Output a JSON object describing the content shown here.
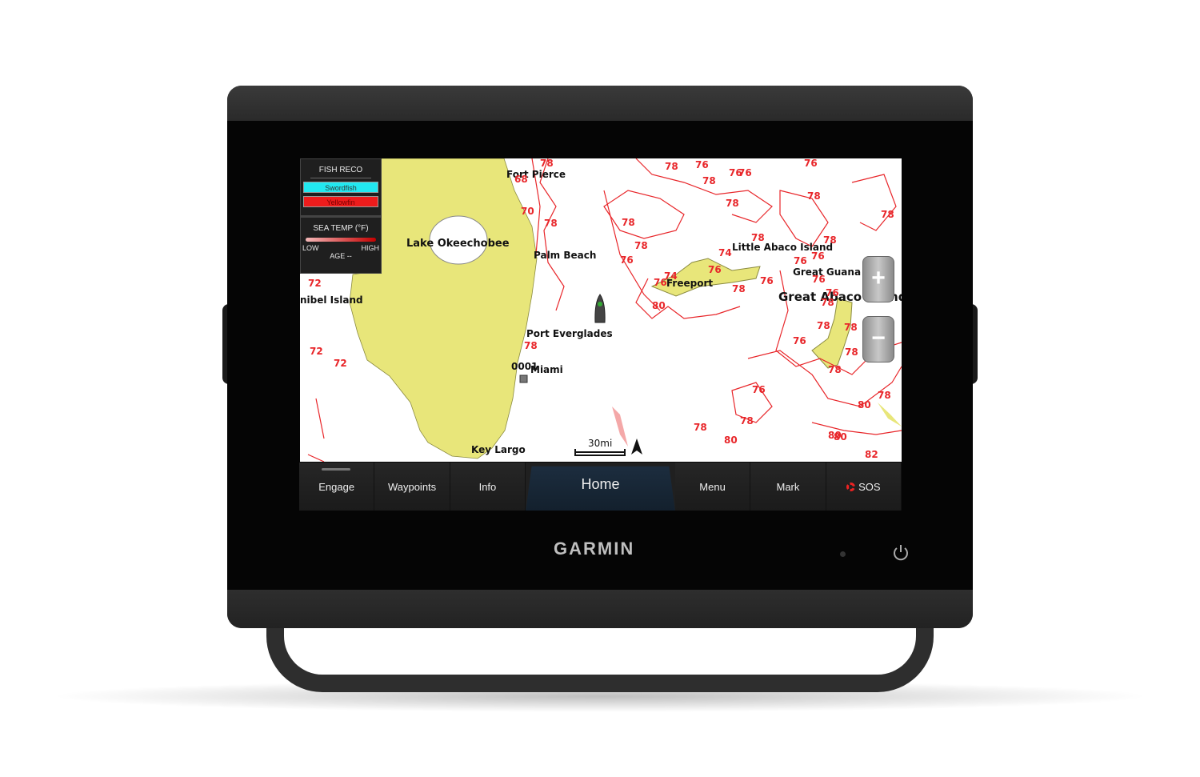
{
  "device": {
    "brand": "GARMIN"
  },
  "legend": {
    "fish_title": "FISH RECO",
    "fish": [
      {
        "label": "Swordfish",
        "color": "#22e8f0"
      },
      {
        "label": "Yellowfin",
        "color": "#ee1c1c"
      }
    ],
    "temp_title": "SEA TEMP (°F)",
    "low": "LOW",
    "high": "HIGH",
    "age": "AGE --"
  },
  "map": {
    "land_color": "#e8e67a",
    "contour_color": "#e8262a",
    "places": [
      "Fort Pierce",
      "Lake Okeechobee",
      "Palm Beach",
      "Port Everglades",
      "Miami",
      "Key Largo",
      "nibel Island",
      "Little Abaco Island",
      "Freeport",
      "Great Guana Cay",
      "Great Abaco Island"
    ],
    "waypoint": "0001",
    "temps": [
      "78",
      "68",
      "70",
      "78",
      "72",
      "72",
      "72",
      "78",
      "78",
      "78",
      "78",
      "78",
      "78",
      "76",
      "76",
      "76",
      "76",
      "78",
      "78",
      "76",
      "80",
      "80",
      "74",
      "76",
      "76",
      "74",
      "78",
      "76",
      "76",
      "76",
      "78",
      "78",
      "76",
      "76",
      "78",
      "76",
      "78",
      "78",
      "78",
      "76",
      "78",
      "78",
      "78",
      "80",
      "80",
      "80",
      "82",
      "78"
    ],
    "scale": "30mi"
  },
  "zoom": {
    "in": "+",
    "out": "−"
  },
  "buttons": [
    "Engage",
    "Waypoints",
    "Info",
    "Home",
    "Menu",
    "Mark",
    "SOS"
  ]
}
